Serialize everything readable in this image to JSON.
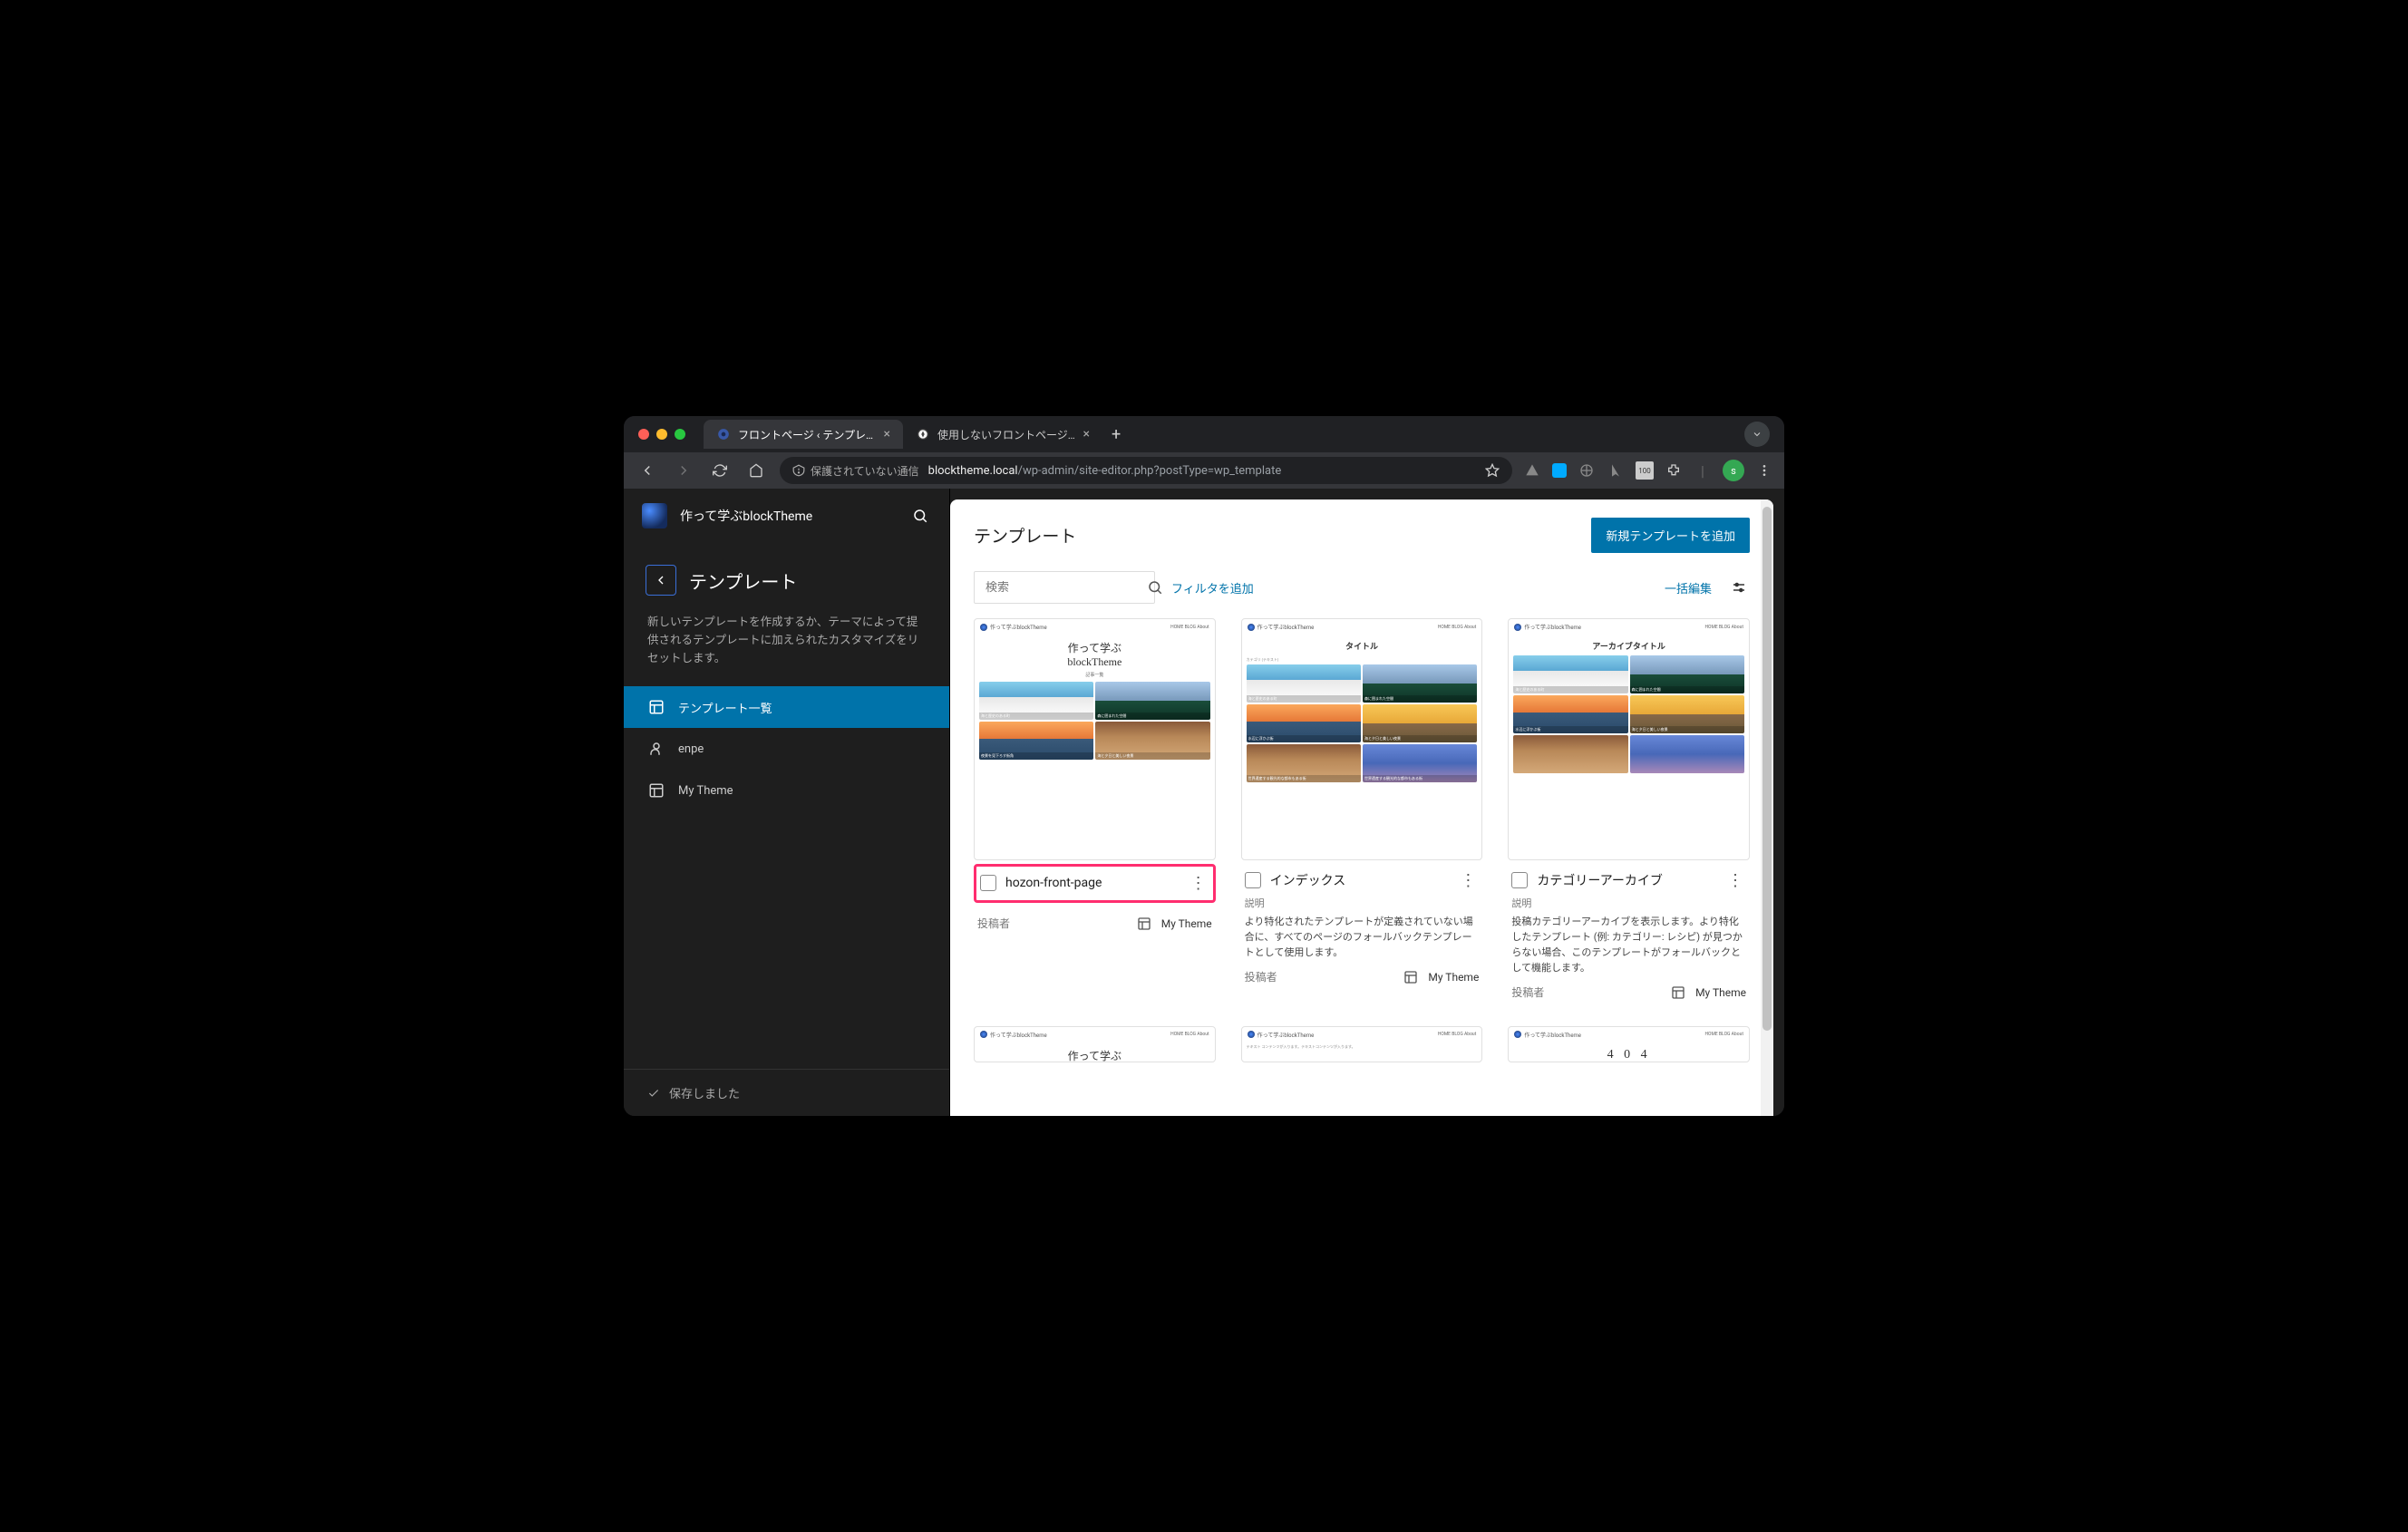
{
  "browser": {
    "tabs": [
      {
        "title": "フロントページ ‹ テンプレート ‹",
        "active": true
      },
      {
        "title": "使用しないフロントページの保存",
        "active": false
      }
    ],
    "security_label": "保護されていない通信",
    "url_host": "blocktheme.local",
    "url_path": "/wp-admin/site-editor.php?postType=wp_template"
  },
  "sidebar": {
    "site_title": "作って学ぶblockTheme",
    "panel_title": "テンプレート",
    "description": "新しいテンプレートを作成するか、テーマによって提供されるテンプレートに加えられたカスタマイズをリセットします。",
    "items": [
      {
        "label": "テンプレート一覧",
        "icon": "layout",
        "active": true
      },
      {
        "label": "enpe",
        "icon": "user",
        "active": false
      },
      {
        "label": "My Theme",
        "icon": "layout",
        "active": false
      }
    ],
    "footer_status": "保存しました"
  },
  "main": {
    "heading": "テンプレート",
    "add_button": "新規テンプレートを追加",
    "search_placeholder": "検索",
    "filter_label": "フィルタを追加",
    "bulk_label": "一括編集",
    "desc_label": "説明",
    "author_label": "投稿者",
    "cards": [
      {
        "title": "hozon-front-page",
        "highlighted": true,
        "description": null,
        "author": "My Theme",
        "preview_title1": "作って学ぶ",
        "preview_title2": "blockTheme",
        "preview_sub": "記事一覧"
      },
      {
        "title": "インデックス",
        "highlighted": false,
        "description": "より特化されたテンプレートが定義されていない場合に、すべてのページのフォールバックテンプレートとして使用します。",
        "author": "My Theme",
        "preview_title1": "タイトル",
        "preview_title2": "",
        "preview_sub": ""
      },
      {
        "title": "カテゴリーアーカイブ",
        "highlighted": false,
        "description": "投稿カテゴリーアーカイブを表示します。より特化したテンプレート (例: カテゴリー: レシピ) が見つからない場合、このテンプレートがフォールバックとして機能します。",
        "author": "My Theme",
        "preview_title1": "アーカイブタイトル",
        "preview_title2": "",
        "preview_sub": ""
      }
    ],
    "preview_brand": "作って学ぶblockTheme",
    "preview_nav": "HOME BLOG About",
    "tile_captions": [
      "海と歴史のある町",
      "森に囲まれた空間",
      "水辺に浮かぶ街",
      "海と夕日と美しい夜景",
      "夜景を見下ろす街角",
      "海と夕日と美しい夜景",
      "世界遺産する観光的な都市もある街"
    ],
    "peek_title": "作って学ぶ",
    "peek_404": "4 0 4"
  }
}
